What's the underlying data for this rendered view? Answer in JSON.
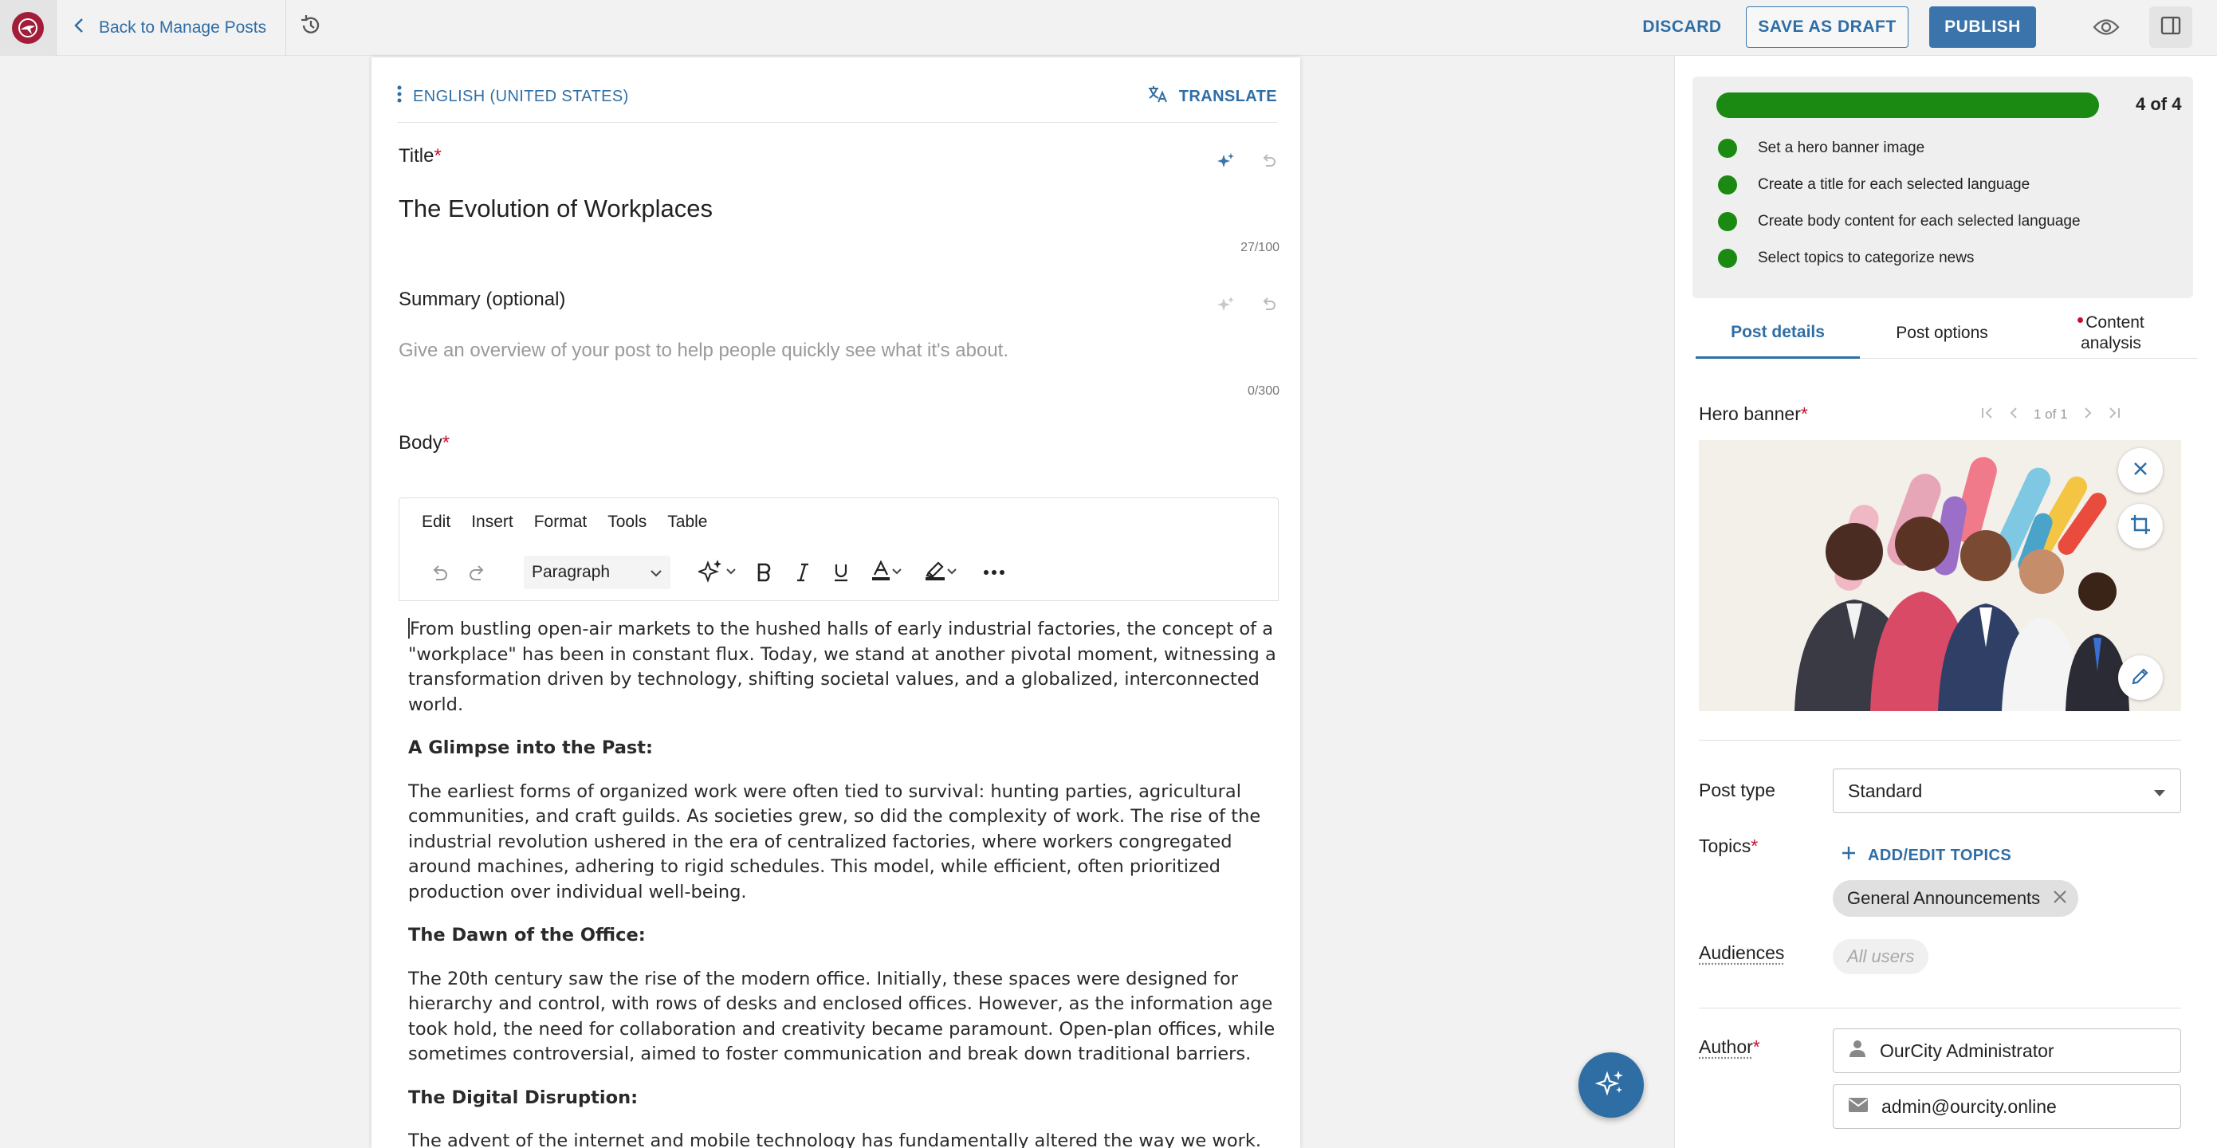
{
  "topbar": {
    "back_label": "Back to Manage Posts",
    "discard_label": "DISCARD",
    "save_draft_label": "SAVE AS DRAFT",
    "publish_label": "PUBLISH",
    "icons": [
      "logo-icon",
      "chevron-left-icon",
      "history-icon",
      "eye-icon",
      "panel-toggle-icon"
    ]
  },
  "editor": {
    "language": "ENGLISH (UNITED STATES)",
    "translate_label": "TRANSLATE",
    "title_label": "Title",
    "title_value": "The Evolution of Workplaces",
    "title_counter": "27/100",
    "summary_label": "Summary (optional)",
    "summary_placeholder": "Give an overview of your post to help people quickly see what it's about.",
    "summary_counter": "0/300",
    "body_label": "Body",
    "required_mark": "*",
    "menus": [
      "Edit",
      "Insert",
      "Format",
      "Tools",
      "Table"
    ],
    "block_format": "Paragraph",
    "body": [
      {
        "type": "p",
        "text": "From bustling open-air markets to the hushed halls of early industrial factories, the concept of a \"workplace\" has been in constant flux. Today, we stand at another pivotal moment, witnessing a transformation driven by technology, shifting societal values, and a globalized, interconnected world."
      },
      {
        "type": "h",
        "text": "A Glimpse into the Past:"
      },
      {
        "type": "p",
        "text": "The earliest forms of organized work were often tied to survival: hunting parties, agricultural communities, and craft guilds. As societies grew, so did the complexity of work. The rise of the industrial revolution ushered in the era of centralized factories, where workers congregated around machines, adhering to rigid schedules. This model, while efficient, often prioritized production over individual well-being."
      },
      {
        "type": "h",
        "text": "The Dawn of the Office:"
      },
      {
        "type": "p",
        "text": "The 20th century saw the rise of the modern office. Initially, these spaces were designed for hierarchy and control, with rows of desks and enclosed offices. However, as the information age took hold, the need for collaboration and creativity became paramount. Open-plan offices, while sometimes controversial, aimed to foster communication and break down traditional barriers."
      },
      {
        "type": "h",
        "text": "The Digital Disruption:"
      },
      {
        "type": "p",
        "text": "The advent of the internet and mobile technology has fundamentally altered the way we work. The"
      }
    ]
  },
  "checklist": {
    "progress_text": "4 of 4",
    "progress_fraction": 1.0,
    "items": [
      "Set a hero banner image",
      "Create a title for each selected language",
      "Create body content for each selected language",
      "Select topics to categorize news"
    ]
  },
  "tabs": [
    {
      "label": "Post details",
      "active": true
    },
    {
      "label": "Post options",
      "active": false
    },
    {
      "label": "Content analysis",
      "active": false
    }
  ],
  "details": {
    "hero_label": "Hero banner",
    "pager_text": "1 of 1",
    "post_type_label": "Post type",
    "post_type_value": "Standard",
    "topics_label": "Topics",
    "add_topics_label": "ADD/EDIT TOPICS",
    "topic_chip": "General Announcements",
    "audiences_label": "Audiences",
    "audiences_placeholder": "All users",
    "author_label": "Author",
    "author_name": "OurCity Administrator",
    "author_email": "admin@ourcity.online"
  },
  "colors": {
    "accent": "#2f6ea5",
    "publish_bg": "#3a74aa",
    "success": "#1a8a12",
    "required": "#c8102e",
    "logo": "#a31d3a"
  }
}
